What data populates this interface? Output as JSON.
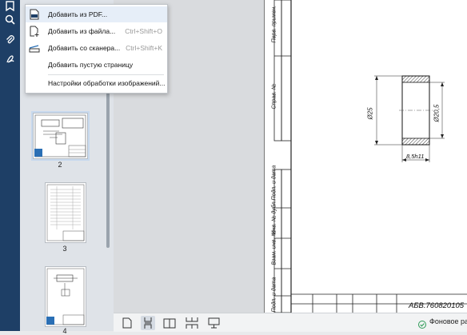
{
  "menu": {
    "items": [
      {
        "label": "Добавить из PDF...",
        "shortcut": ""
      },
      {
        "label": "Добавить из файла...",
        "shortcut": "Ctrl+Shift+O"
      },
      {
        "label": "Добавить со сканера...",
        "shortcut": "Ctrl+Shift+K"
      },
      {
        "label": "Добавить пустую страницу",
        "shortcut": ""
      },
      {
        "label": "Настройки обработки изображений...",
        "shortcut": ""
      }
    ]
  },
  "thumbnails": {
    "pages": [
      {
        "number": "2"
      },
      {
        "number": "3"
      },
      {
        "number": "4"
      }
    ]
  },
  "drawing": {
    "dim_diameter_outer": "Ø25",
    "dim_diameter_inner": "Ø20,5",
    "dim_width": "8,5h11",
    "side_labels": [
      "Перв. примен.",
      "Справ. №",
      "Подп. и дата",
      "Инв. № дубл.",
      "Взам. инв. №",
      "Подп. и дата"
    ],
    "title_code": "АБВ.760820105"
  },
  "statusbar": {
    "background_task": "Фоновое ра"
  },
  "icons": {
    "left": [
      "bookmark-icon",
      "search-icon",
      "attachment-icon",
      "signature-icon"
    ],
    "bottom": [
      "single-page-icon",
      "continuous-scroll-icon",
      "two-page-icon",
      "two-page-scroll-icon",
      "presentation-icon"
    ]
  },
  "colors": {
    "sidebar": "#1e3f66",
    "accent": "#2a6fb5",
    "ok": "#2e9b58"
  }
}
